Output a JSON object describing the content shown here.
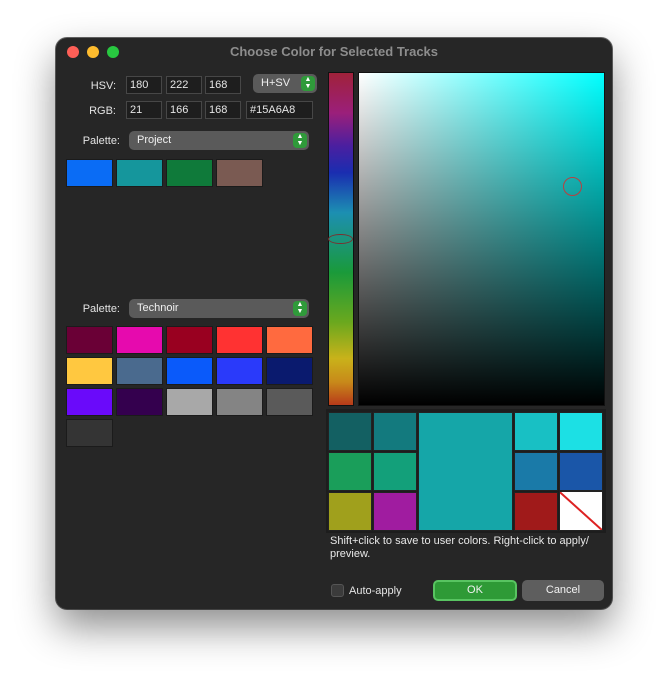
{
  "dialog": {
    "title": "Choose Color for Selected Tracks"
  },
  "hsv": {
    "label": "HSV:",
    "h": "180",
    "s": "222",
    "v": "168",
    "mode": "H+SV"
  },
  "rgb": {
    "label": "RGB:",
    "r": "21",
    "g": "166",
    "b": "168",
    "hex": "#15A6A8"
  },
  "palette1": {
    "label": "Palette:",
    "value": "Project",
    "colors": [
      "#0a6cf5",
      "#15969c",
      "#0f7a3a",
      "#7a5a52"
    ]
  },
  "palette2": {
    "label": "Palette:",
    "value": "Technoir",
    "colors": [
      "#6a0036",
      "#e60aae",
      "#990020",
      "#ff3232",
      "#ff6a3f",
      "#ffc840",
      "#4a6a8e",
      "#0a5afa",
      "#2a3afa",
      "#0a1a6e",
      "#6a0afa",
      "#34004e",
      "#a8a8a8",
      "#848484",
      "#5a5a5a",
      "#343434"
    ]
  },
  "current_color": "#15A6A8",
  "recent_colors": {
    "left": [
      "#136062",
      "#137a7e",
      "#1a9e5a",
      "#13a07a",
      "#a0a01c",
      "#a01ca0"
    ],
    "right": [
      "#18c0c4",
      "#1ce0e4",
      "#1a7aa8",
      "#1a56a8",
      "#a01a1a"
    ]
  },
  "hint": "Shift+click to save to user colors. Right-click to apply/ preview.",
  "auto_apply": {
    "label": "Auto-apply",
    "checked": false
  },
  "buttons": {
    "ok": "OK",
    "cancel": "Cancel"
  }
}
